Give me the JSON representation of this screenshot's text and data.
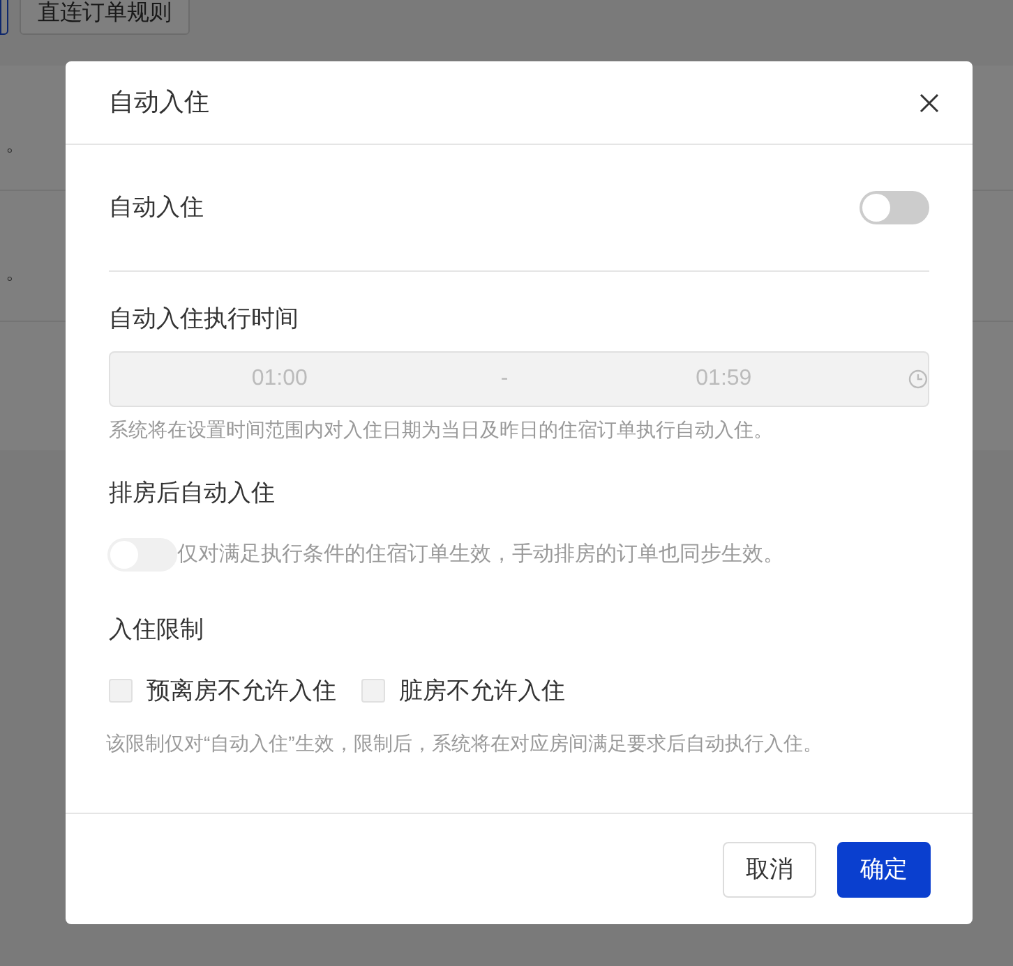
{
  "background": {
    "top_button": "直连订单规则",
    "rows": [
      {
        "text": "。"
      },
      {
        "text": "。"
      },
      {
        "text": ""
      }
    ]
  },
  "dialog": {
    "title": "自动入住",
    "auto_checkin": {
      "label": "自动入住",
      "on": false
    },
    "time_range": {
      "label": "自动入住执行时间",
      "start": "01:00",
      "separator": "-",
      "end": "01:59",
      "disabled": true,
      "hint": "系统将在设置时间范围内对入住日期为当日及昨日的住宿订单执行自动入住。"
    },
    "after_assign": {
      "label": "排房后自动入住",
      "on": false,
      "disabled": true,
      "note": "仅对满足执行条件的住宿订单生效，手动排房的订单也同步生效。"
    },
    "restrictions": {
      "label": "入住限制",
      "options": [
        {
          "label": "预离房不允许入住",
          "checked": false,
          "disabled": true
        },
        {
          "label": "脏房不允许入住",
          "checked": false,
          "disabled": true
        }
      ],
      "hint": "该限制仅对“自动入住”生效，限制后，系统将在对应房间满足要求后自动执行入住。"
    },
    "buttons": [
      {
        "label": "取消",
        "kind": "secondary"
      },
      {
        "label": "确定",
        "kind": "primary"
      }
    ]
  }
}
